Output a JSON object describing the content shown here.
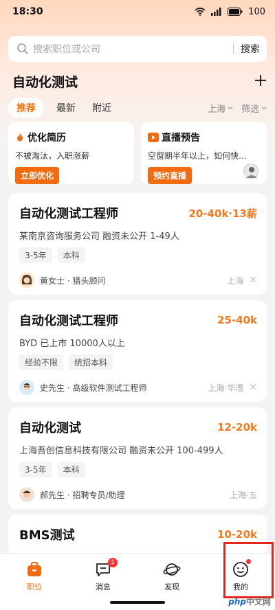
{
  "status_bar": {
    "time": "18:30",
    "battery": "100"
  },
  "search": {
    "placeholder": "搜索职位或公司",
    "button": "搜索"
  },
  "header": {
    "title": "自动化测试",
    "add_icon": "plus-icon"
  },
  "tabs": [
    {
      "label": "推荐",
      "active": true
    },
    {
      "label": "最新",
      "active": false
    },
    {
      "label": "附近",
      "active": false
    }
  ],
  "filters": {
    "city": "上海",
    "filter": "筛选"
  },
  "promos": [
    {
      "title": "优化简历",
      "icon": "flame-icon",
      "desc": "不被淘汰，入职涨薪",
      "button": "立即优化"
    },
    {
      "title": "直播预告",
      "icon": "play-icon",
      "desc": "空窗期半年以上，如何快…",
      "button": "预约直播"
    }
  ],
  "jobs": [
    {
      "title": "自动化测试工程师",
      "salary": "20-40k·13薪",
      "company_line": "某南京咨询服务公司  融资未公开  1-49人",
      "tags": [
        "3-5年",
        "本科"
      ],
      "recruiter": "黄女士 · 猎头顾问",
      "location": "上海"
    },
    {
      "title": "自动化测试工程师",
      "salary": "25-40k",
      "company_line": "BYD  已上市  10000人以上",
      "tags": [
        "经验不限",
        "统招本科"
      ],
      "recruiter": "史先生 · 高级软件测试工程师",
      "location": "上海·华漕"
    },
    {
      "title": "自动化测试",
      "salary": "12-20k",
      "company_line": "上海吾创信息科技有限公司  融资未公开  100-499人",
      "tags": [
        "3-5年",
        "本科"
      ],
      "recruiter": "郝先生 · 招聘专员/助理",
      "location": "上海·五"
    },
    {
      "title": "BMS测试",
      "salary": "10-20k"
    }
  ],
  "bottom_nav": [
    {
      "label": "职位",
      "icon": "briefcase-icon",
      "active": true
    },
    {
      "label": "消息",
      "icon": "chat-icon",
      "badge": "1"
    },
    {
      "label": "发现",
      "icon": "planet-icon"
    },
    {
      "label": "我的",
      "icon": "smiley-icon"
    }
  ],
  "watermark": {
    "brand": "php",
    "text": "中文网"
  },
  "colors": {
    "accent": "#f26b0f",
    "salary": "#f37a1f",
    "highlight": "#e3261b"
  }
}
